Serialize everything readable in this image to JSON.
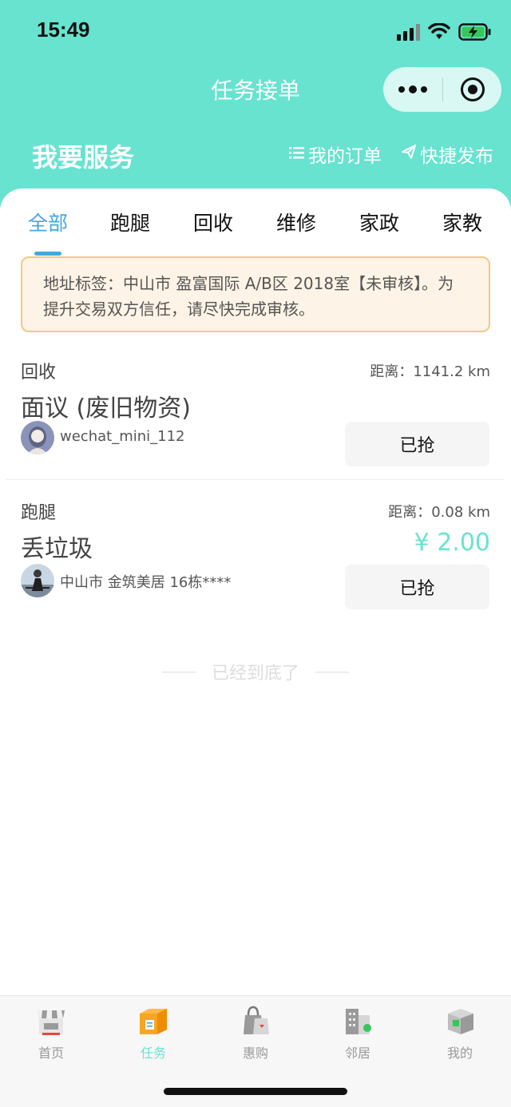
{
  "status_bar": {
    "time": "15:49"
  },
  "nav": {
    "title": "任务接单"
  },
  "header": {
    "title": "我要服务",
    "my_orders": "我的订单",
    "quick_publish": "快捷发布"
  },
  "tabs": [
    {
      "label": "全部"
    },
    {
      "label": "跑腿"
    },
    {
      "label": "回收"
    },
    {
      "label": "维修"
    },
    {
      "label": "家政"
    },
    {
      "label": "家教"
    }
  ],
  "notice": {
    "text": "地址标签：中山市 盈富国际 A/B区 2018室【未审核】。为提升交易双方信任，请尽快完成审核。"
  },
  "tasks": [
    {
      "category": "回收",
      "distance": "距离：1141.2 km",
      "title": "面议 (废旧物资)",
      "price": "",
      "user": "wechat_mini_112",
      "action": "已抢"
    },
    {
      "category": "跑腿",
      "distance": "距离：0.08 km",
      "title": "丢垃圾",
      "price": "¥ 2.00",
      "user": "中山市 金筑美居 16栋****",
      "action": "已抢"
    }
  ],
  "end_text": "已经到底了",
  "tabbar": [
    {
      "label": "首页",
      "icon": "shop-icon"
    },
    {
      "label": "任务",
      "icon": "task-box-icon"
    },
    {
      "label": "惠购",
      "icon": "shopping-bag-icon"
    },
    {
      "label": "邻居",
      "icon": "building-icon"
    },
    {
      "label": "我的",
      "icon": "profile-cube-icon"
    }
  ],
  "colors": {
    "accent": "#67e3d0",
    "tab_active": "#3fa9e0",
    "notice_bg": "#fdf3e6",
    "notice_border": "#f3c887"
  }
}
